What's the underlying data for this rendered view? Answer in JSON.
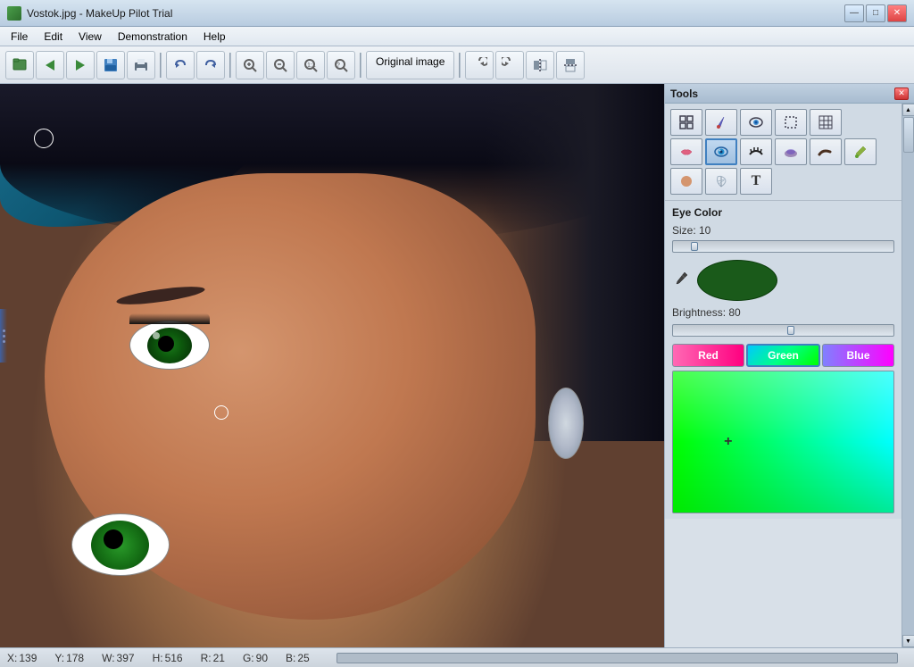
{
  "window": {
    "title": "Vostok.jpg - MakeUp Pilot Trial",
    "icon": "✿"
  },
  "title_controls": {
    "minimize": "—",
    "maximize": "□",
    "close": "✕"
  },
  "menu": {
    "items": [
      "File",
      "Edit",
      "View",
      "Demonstration",
      "Help"
    ]
  },
  "toolbar": {
    "original_image_label": "Original image"
  },
  "tools_panel": {
    "title": "Tools",
    "close": "✕",
    "rows": [
      [
        "⊞",
        "✏",
        "◉",
        "⊡",
        "⊞"
      ],
      [
        "💄",
        "👁",
        "🖌",
        "≋",
        "≈",
        "⚗"
      ]
    ]
  },
  "eye_color": {
    "section_label": "Eye Color",
    "size_label": "Size: 10",
    "brightness_label": "Brightness: 80",
    "thumb_left_pct": 10,
    "brightness_thumb_pct": 55,
    "channels": {
      "red": "Red",
      "green": "Green",
      "blue": "Blue"
    }
  },
  "status_bar": {
    "x_label": "X:",
    "x_val": "139",
    "y_label": "Y:",
    "y_val": "178",
    "w_label": "W:",
    "w_val": "397",
    "h_label": "H:",
    "h_val": "516",
    "r_label": "R:",
    "r_val": "21",
    "g_label": "G:",
    "g_val": "90",
    "b_label": "B:",
    "b_val": "25"
  }
}
